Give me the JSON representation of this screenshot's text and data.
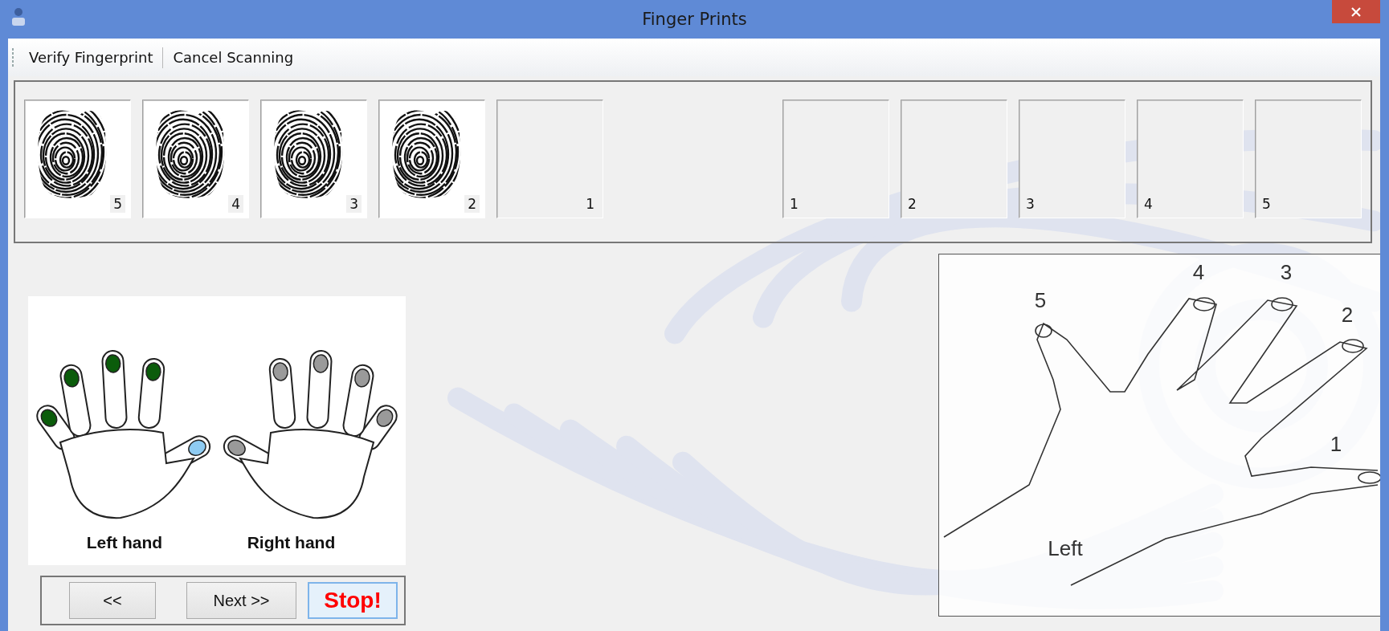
{
  "window": {
    "title": "Finger Prints"
  },
  "toolbar": [
    {
      "label": "Verify Fingerprint"
    },
    {
      "label": "Cancel Scanning"
    }
  ],
  "scanned_slots": [
    {
      "number": "5",
      "captured": true
    },
    {
      "number": "4",
      "captured": true
    },
    {
      "number": "3",
      "captured": true
    },
    {
      "number": "2",
      "captured": true
    },
    {
      "number": "1",
      "captured": false
    }
  ],
  "reference_slots": [
    {
      "number": "1"
    },
    {
      "number": "2"
    },
    {
      "number": "3"
    },
    {
      "number": "4"
    },
    {
      "number": "5"
    }
  ],
  "hands": [
    {
      "label": "Left hand",
      "fingers": [
        {
          "color": "#0b5c0b"
        },
        {
          "color": "#0b5c0b"
        },
        {
          "color": "#0b5c0b"
        },
        {
          "color": "#0b5c0b"
        },
        {
          "color": "#8ecbf2"
        }
      ]
    },
    {
      "label": "Right hand",
      "fingers": [
        {
          "color": "#9a9a9a"
        },
        {
          "color": "#9a9a9a"
        },
        {
          "color": "#9a9a9a"
        },
        {
          "color": "#9a9a9a"
        },
        {
          "color": "#9a9a9a"
        }
      ]
    }
  ],
  "buttons": [
    {
      "label": "<<",
      "kind": "nav"
    },
    {
      "label": "Next >>",
      "kind": "nav"
    },
    {
      "label": "Stop!",
      "kind": "stop"
    }
  ],
  "guide_image": {
    "finger_labels": [
      "5",
      "4",
      "3",
      "2",
      "1"
    ],
    "hand_label": "Left"
  }
}
